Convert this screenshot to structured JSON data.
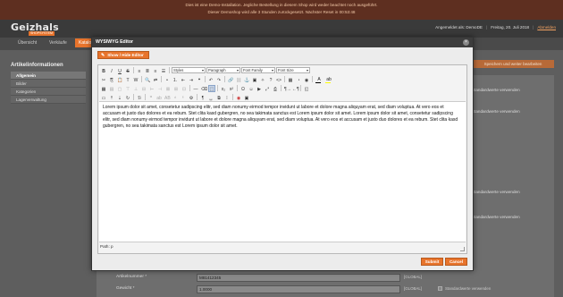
{
  "banner": {
    "line1": "Dies ist eine Demo-Installation. Jegliche Bestellung in diesem Shop wird weder beachtet noch ausgeführt.",
    "line2": "Dieser Demoshop wird alle 3 Stunden zurückgesetzt. Nächster Reset in 00:53:48"
  },
  "header": {
    "logo": "Geizhals",
    "logo_sub": "SHOPSYSTEM",
    "user": "Angemeldet als: DemoDE",
    "date": "Freitag, 20. Juli 2018",
    "logout": "Abmelden"
  },
  "nav": {
    "items": [
      "Übersicht",
      "Verkäufe",
      "Katalog"
    ]
  },
  "sidebar": {
    "title": "Artikelinformationen",
    "items": [
      "Allgemein",
      "Bilder",
      "Kategorien",
      "Lagerverwaltung"
    ]
  },
  "actions": {
    "save_continue": "Speichern und weiter bearbeiten"
  },
  "form": {
    "use_default": "Standardwerte verwenden",
    "rows": [
      {
        "label": "Artikelnummer *",
        "value": "M81412345",
        "scope": "[GLOBAL]"
      },
      {
        "label": "Gewicht *",
        "value": "1.0000",
        "scope": "[GLOBAL]",
        "check": "Standardwerte verwenden"
      }
    ]
  },
  "modal": {
    "title": "WYSIWYG Editor",
    "close": "×",
    "toggle_label": "Show / Hide Editor",
    "toolbar": {
      "styles": "Styles",
      "paragraph": "Paragraph",
      "font_family": "Font Family",
      "font_size": "Font Size"
    },
    "content": "Lorem ipsum dolor sit amet, consetetur sadipscing elitr, sed diam nonumy eirmod tempor invidunt ut labore et dolore magna aliquyam erat, sed diam voluptua. At vero eos et accusam et justo duo dolores et ea rebum. Stet clita kasd gubergren, no sea takimata sanctus est Lorem ipsum dolor sit amet. Lorem ipsum dolor sit amet, consetetur sadipscing elitr, sed diam nonumy eirmod tempor invidunt ut labore et dolore magna aliquyam erat, sed diam voluptua. At vero eos et accusam et justo duo dolores et ea rebum. Stet clita kasd gubergren, no sea takimata sanctus est Lorem ipsum dolor sit amet.",
    "path": "Path: p",
    "submit": "Submit",
    "cancel": "Cancel"
  },
  "colors": {
    "accent": "#e8742c",
    "banner_bg": "#5e2f20",
    "header_bg": "#3a3a3a"
  }
}
